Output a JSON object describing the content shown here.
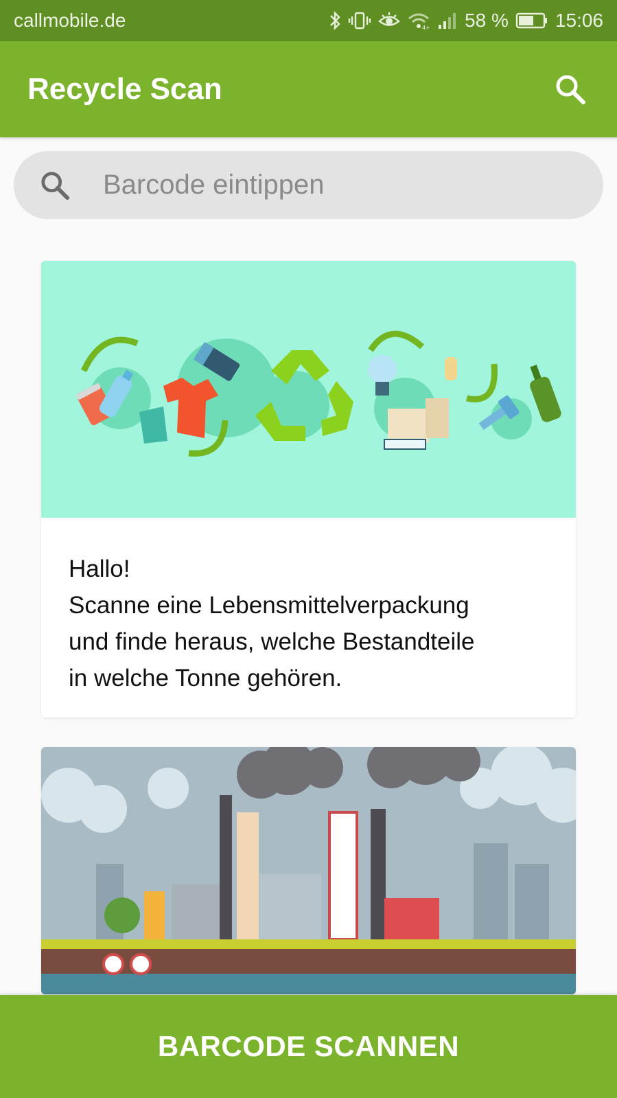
{
  "status_bar": {
    "carrier": "callmobile.de",
    "battery": "58 %",
    "time": "15:06",
    "icons": [
      "bluetooth-icon",
      "vibrate-icon",
      "eye-icon",
      "wifi-icon",
      "signal-icon",
      "battery-icon"
    ]
  },
  "app_bar": {
    "title": "Recycle Scan",
    "search_icon": "search-icon",
    "color": "#7cb32d"
  },
  "search": {
    "placeholder": "Barcode eintippen",
    "value": "",
    "icon": "search-icon"
  },
  "cards": [
    {
      "image": "recycling-illustration",
      "lines": [
        "Hallo!",
        "Scanne eine Lebensmittelverpackung",
        "und finde heraus, welche Bestandteile",
        "in welche Tonne gehören."
      ]
    },
    {
      "image": "factory-pollution-illustration"
    }
  ],
  "bottom_button": {
    "label": "BARCODE SCANNEN"
  },
  "colors": {
    "status_bar": "#5f8f22",
    "primary": "#7cb32d",
    "illustration_bg": "#a0f5dc",
    "recycle_arrow": "#8cd11e"
  }
}
